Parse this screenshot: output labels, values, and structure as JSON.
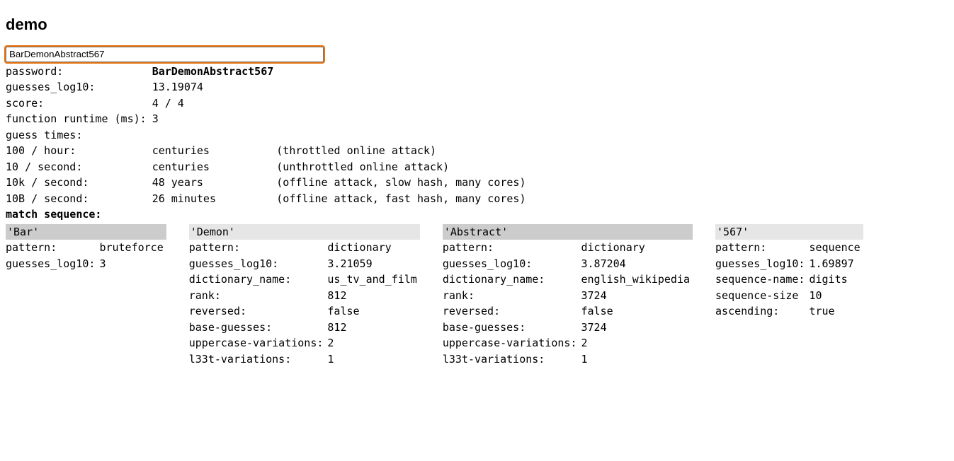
{
  "title": "demo",
  "input": {
    "value": "BarDemonAbstract567"
  },
  "summary": {
    "password_label": "password:",
    "password_value": "BarDemonAbstract567",
    "guesses_log10_label": "guesses_log10:",
    "guesses_log10_value": "13.19074",
    "score_label": "score:",
    "score_value": "4 / 4",
    "runtime_label": "function runtime (ms):",
    "runtime_value": "3",
    "guess_times_label": "guess times:",
    "rows": [
      {
        "rate": "100 / hour:",
        "time": "centuries",
        "desc": "(throttled online attack)"
      },
      {
        "rate": "10  / second:",
        "time": "centuries",
        "desc": "(unthrottled online attack)"
      },
      {
        "rate": "10k / second:",
        "time": "48 years",
        "desc": "(offline attack, slow hash, many cores)"
      },
      {
        "rate": "10B / second:",
        "time": "26 minutes",
        "desc": "(offline attack, fast hash, many cores)"
      }
    ],
    "match_sequence_label": "match sequence:"
  },
  "matches": [
    {
      "token": "'Bar'",
      "rows": [
        {
          "k": "pattern:",
          "v": "bruteforce"
        },
        {
          "k": "guesses_log10:",
          "v": "3"
        }
      ]
    },
    {
      "token": "'Demon'",
      "rows": [
        {
          "k": "pattern:",
          "v": "dictionary"
        },
        {
          "k": "guesses_log10:",
          "v": "3.21059"
        },
        {
          "k": "dictionary_name:",
          "v": "us_tv_and_film"
        },
        {
          "k": "rank:",
          "v": "812"
        },
        {
          "k": "reversed:",
          "v": "false"
        },
        {
          "k": "base-guesses:",
          "v": "812"
        },
        {
          "k": "uppercase-variations:",
          "v": "2"
        },
        {
          "k": "l33t-variations:",
          "v": "1"
        }
      ]
    },
    {
      "token": "'Abstract'",
      "rows": [
        {
          "k": "pattern:",
          "v": "dictionary"
        },
        {
          "k": "guesses_log10:",
          "v": "3.87204"
        },
        {
          "k": "dictionary_name:",
          "v": "english_wikipedia"
        },
        {
          "k": "rank:",
          "v": "3724"
        },
        {
          "k": "reversed:",
          "v": "false"
        },
        {
          "k": "base-guesses:",
          "v": "3724"
        },
        {
          "k": "uppercase-variations:",
          "v": "2"
        },
        {
          "k": "l33t-variations:",
          "v": "1"
        }
      ]
    },
    {
      "token": "'567'",
      "rows": [
        {
          "k": "pattern:",
          "v": "sequence"
        },
        {
          "k": "guesses_log10:",
          "v": "1.69897"
        },
        {
          "k": "sequence-name:",
          "v": "digits"
        },
        {
          "k": "sequence-size",
          "v": "10"
        },
        {
          "k": "ascending:",
          "v": "true"
        }
      ]
    }
  ]
}
